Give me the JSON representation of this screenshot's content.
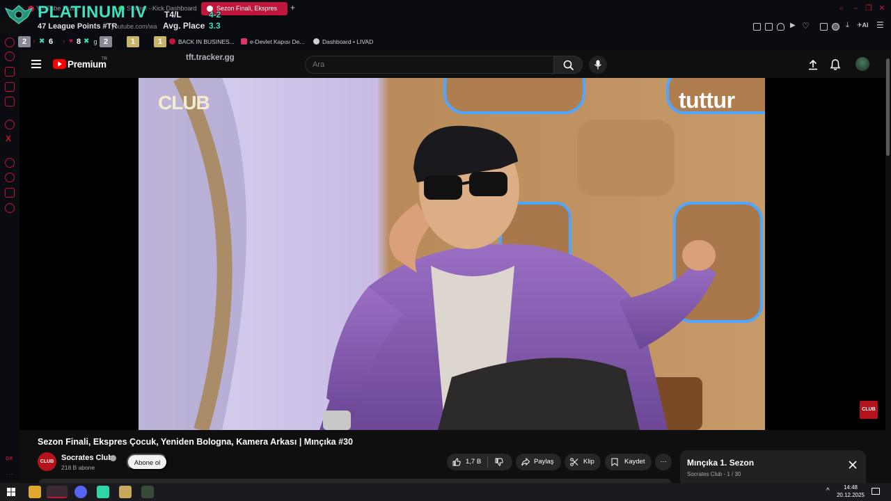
{
  "browser": {
    "tabs": [
      {
        "label": "YouTube Music"
      },
      {
        "label": "Stream - Kick Dashboard"
      },
      {
        "label": "Sezon Finali, Ekspres"
      }
    ],
    "new_tab_symbol": "+",
    "address_partial": "youtube.com/wa",
    "bookmarks": [
      {
        "label": "BACK IN BUSINES...",
        "icon": "youtube-icon"
      },
      {
        "label": "e-Devlet Kapısı De...",
        "icon": "edevlet-icon"
      },
      {
        "label": "Dashboard • LIVAD",
        "icon": "discord-icon"
      }
    ],
    "sidebar_bottom_label": "GX",
    "accent": "#c0163b"
  },
  "overlay": {
    "rank": "PLATINUM IV",
    "league_points": "47 League Points #TR",
    "top4_label": "T4/L",
    "top4_value": "4-2",
    "avg_label": "Avg. Place",
    "avg_value": "3.3",
    "history": [
      "2",
      "6",
      "8",
      "2",
      "1",
      "1"
    ],
    "history_extra": "g",
    "tracker_site": "tft.tracker.gg",
    "accent": "#3fe0c0"
  },
  "youtube": {
    "brand": "Premium",
    "country": "TR",
    "search_placeholder": "Ara",
    "video": {
      "title": "Sezon Finali, Ekspres Çocuk, Yeniden Bologna, Kamera Arkası | Mınçıka #30",
      "watermark_left": "CLUB",
      "watermark_right": "tuttur",
      "corner_logo": "CLUB"
    },
    "channel": {
      "avatar_text": "CLUB",
      "name": "Socrates Club",
      "subscribers": "218 B abone",
      "subscribe_label": "Abone ol"
    },
    "actions": {
      "like_count": "1,7 B",
      "share_label": "Paylaş",
      "clip_label": "Klip",
      "save_label": "Kaydet",
      "more_label": "···"
    },
    "playlist": {
      "title": "Mınçıka 1. Sezon",
      "meta": "Socrates Club - 1 / 30"
    }
  },
  "taskbar": {
    "time": "14:48",
    "date": "20.12.2025"
  }
}
